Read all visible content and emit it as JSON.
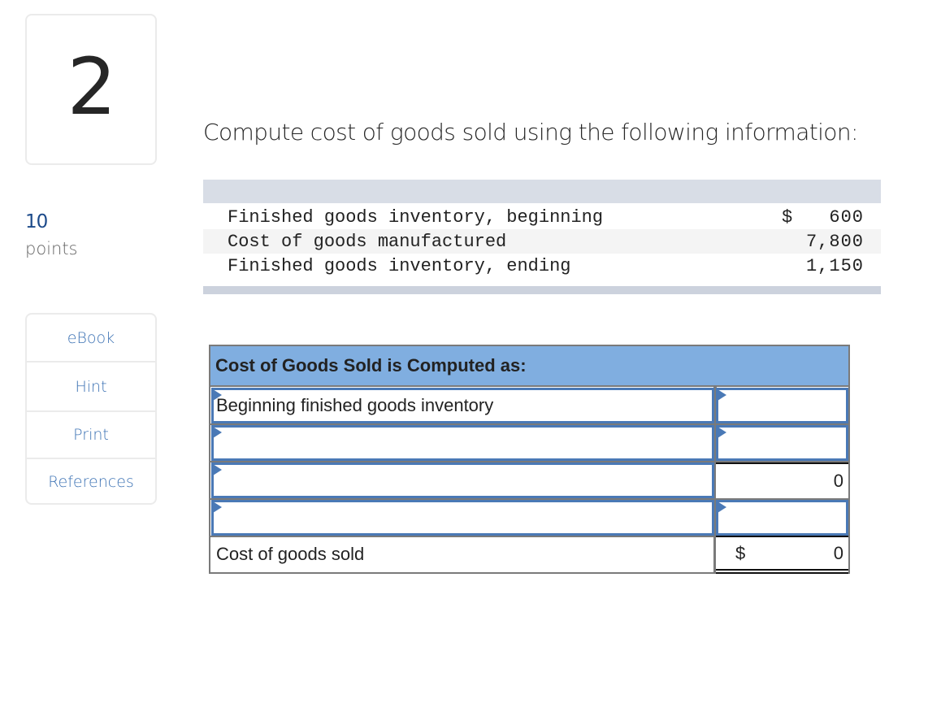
{
  "question_number": "2",
  "points": {
    "value": "10",
    "label": "points"
  },
  "resources": [
    "eBook",
    "Hint",
    "Print",
    "References"
  ],
  "question_text": "Compute cost of goods sold using the following information:",
  "given_data": {
    "rows": [
      {
        "label": "Finished goods inventory, beginning",
        "currency": "$",
        "amount": "600"
      },
      {
        "label": "Cost of goods manufactured",
        "currency": "",
        "amount": "7,800"
      },
      {
        "label": "Finished goods inventory, ending",
        "currency": "",
        "amount": "1,150"
      }
    ]
  },
  "worksheet": {
    "header": "Cost of Goods Sold is Computed as:",
    "rows": [
      {
        "label": "Beginning finished goods inventory",
        "value": "",
        "label_editable": true,
        "value_editable": true
      },
      {
        "label": "",
        "value": "",
        "label_editable": true,
        "value_editable": true
      },
      {
        "label": "",
        "value": "0",
        "label_editable": true,
        "value_editable": false
      },
      {
        "label": "",
        "value": "",
        "label_editable": true,
        "value_editable": true
      }
    ],
    "total": {
      "label": "Cost of goods sold",
      "currency": "$",
      "value": "0"
    }
  },
  "colors": {
    "link": "#3f74b5",
    "points_number": "#1c4a8a",
    "worksheet_header_bg": "#80aee0",
    "input_border": "#4a79b6",
    "given_band": "#d8dde6"
  }
}
